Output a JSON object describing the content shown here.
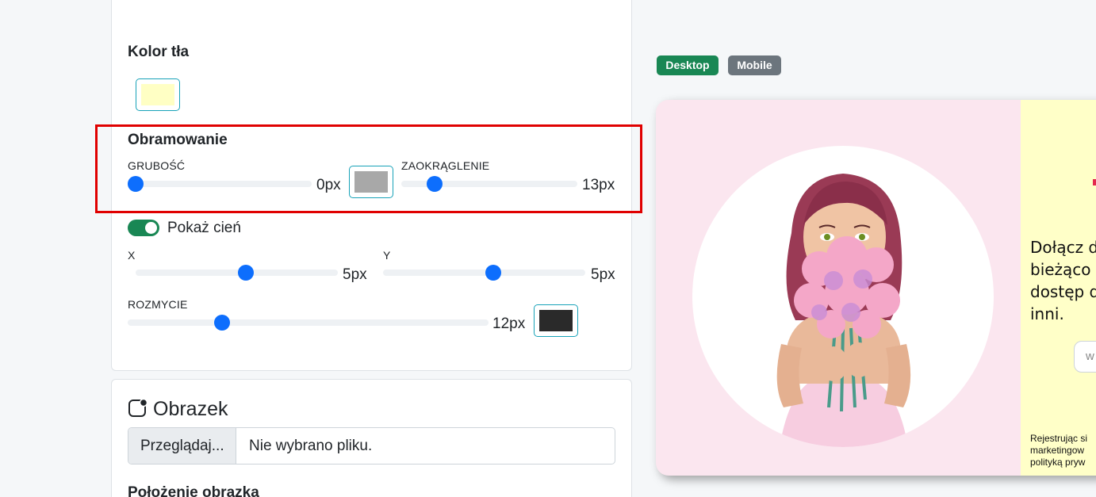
{
  "background": {
    "title": "Kolor tła",
    "color": "#ffffc4"
  },
  "border": {
    "title": "Obramowanie",
    "thickness_label": "GRUBOŚĆ",
    "thickness_value": "0px",
    "thickness_level": 0,
    "color": "#a8a8a8",
    "radius_label": "ZAOKRĄGLENIE",
    "radius_value": "13px",
    "radius_level": 0.16
  },
  "shadow": {
    "toggle_label": "Pokaż cień",
    "enabled": true,
    "x_label": "X",
    "x_value": "5px",
    "x_level": 0.55,
    "y_label": "Y",
    "y_value": "5px",
    "y_level": 0.55,
    "blur_label": "ROZMYCIE",
    "blur_value": "12px",
    "blur_level": 0.25,
    "color": "#2a2a2a"
  },
  "image": {
    "title": "Obrazek",
    "browse_label": "Przeglądaj...",
    "file_status": "Nie wybrano pliku.",
    "position_title": "Położenie obrazka"
  },
  "preview": {
    "tabs": [
      {
        "label": "Desktop",
        "color": "#198754"
      },
      {
        "label": "Mobile",
        "color": "#6c757d"
      }
    ],
    "text": "Dołącz d\nbieżąco \ndostęp d\ninni.",
    "input_placeholder": "w",
    "small_print": "Rejestrując si\nmarketingow\npolityką pryw"
  }
}
